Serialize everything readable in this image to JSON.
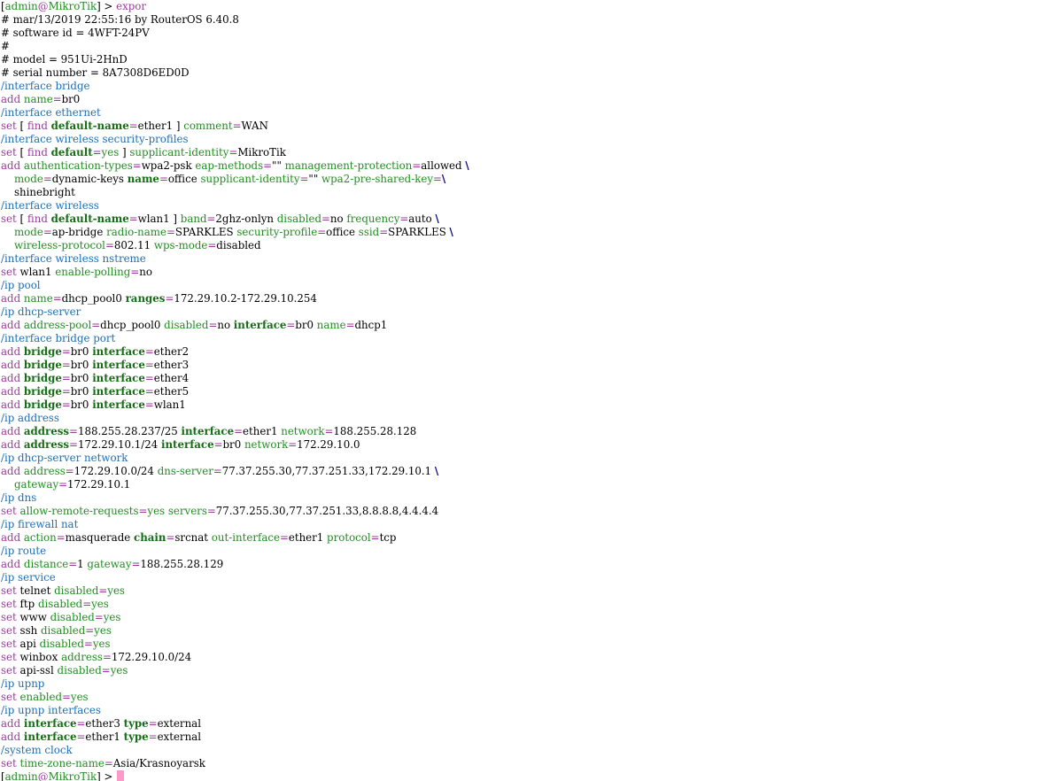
{
  "terminal": {
    "colors": {
      "background": "#ffffff",
      "text": "#000000",
      "section": "#1f6eb5",
      "verb": "#9b3d9b",
      "key": "#238c23",
      "key_bold": "#166d16",
      "continuation": "#000080",
      "cursor": "#ff99cc"
    },
    "lines": [
      [
        [
          "br",
          "["
        ],
        [
          "g",
          "admin"
        ],
        [
          "a",
          "@"
        ],
        [
          "g",
          "MikroTik"
        ],
        [
          "br",
          "] > "
        ],
        [
          "v",
          "expor"
        ]
      ],
      [
        [
          "c",
          "# mar/13/2019 22:55:16 by RouterOS 6.40.8"
        ]
      ],
      [
        [
          "c",
          "# software id = 4WFT-24PV"
        ]
      ],
      [
        [
          "c",
          "#"
        ]
      ],
      [
        [
          "c",
          "# model = 951Ui-2HnD"
        ]
      ],
      [
        [
          "c",
          "# serial number = 8A7308D6ED0D"
        ]
      ],
      [
        [
          "s",
          "/interface bridge"
        ]
      ],
      [
        [
          "v",
          "add "
        ],
        [
          "g",
          "name"
        ],
        [
          "a",
          "="
        ],
        [
          "t",
          "br0"
        ]
      ],
      [
        [
          "s",
          "/interface ethernet"
        ]
      ],
      [
        [
          "v",
          "set "
        ],
        [
          "br",
          "[ "
        ],
        [
          "v",
          "find "
        ],
        [
          "b",
          "default-name"
        ],
        [
          "a",
          "="
        ],
        [
          "t",
          "ether1 "
        ],
        [
          "br",
          "] "
        ],
        [
          "g",
          "comment"
        ],
        [
          "a",
          "="
        ],
        [
          "t",
          "WAN"
        ]
      ],
      [
        [
          "s",
          "/interface wireless security-profiles"
        ]
      ],
      [
        [
          "v",
          "set "
        ],
        [
          "br",
          "[ "
        ],
        [
          "v",
          "find "
        ],
        [
          "b",
          "default"
        ],
        [
          "a",
          "="
        ],
        [
          "g",
          "yes "
        ],
        [
          "br",
          "] "
        ],
        [
          "g",
          "supplicant-identity"
        ],
        [
          "a",
          "="
        ],
        [
          "t",
          "MikroTik"
        ]
      ],
      [
        [
          "v",
          "add "
        ],
        [
          "g",
          "authentication-types"
        ],
        [
          "a",
          "="
        ],
        [
          "t",
          "wpa2-psk "
        ],
        [
          "g",
          "eap-methods"
        ],
        [
          "a",
          "="
        ],
        [
          "t",
          "\"\" "
        ],
        [
          "g",
          "management-protection"
        ],
        [
          "a",
          "="
        ],
        [
          "t",
          "allowed "
        ],
        [
          "x",
          "\\"
        ]
      ],
      [
        [
          "t",
          "    "
        ],
        [
          "g",
          "mode"
        ],
        [
          "a",
          "="
        ],
        [
          "t",
          "dynamic-keys "
        ],
        [
          "b",
          "name"
        ],
        [
          "a",
          "="
        ],
        [
          "t",
          "office "
        ],
        [
          "g",
          "supplicant-identity"
        ],
        [
          "a",
          "="
        ],
        [
          "t",
          "\"\" "
        ],
        [
          "g",
          "wpa2-pre-shared-key"
        ],
        [
          "a",
          "="
        ],
        [
          "x",
          "\\"
        ]
      ],
      [
        [
          "t",
          "    shinebright"
        ]
      ],
      [
        [
          "s",
          "/interface wireless"
        ]
      ],
      [
        [
          "v",
          "set "
        ],
        [
          "br",
          "[ "
        ],
        [
          "v",
          "find "
        ],
        [
          "b",
          "default-name"
        ],
        [
          "a",
          "="
        ],
        [
          "t",
          "wlan1 "
        ],
        [
          "br",
          "] "
        ],
        [
          "g",
          "band"
        ],
        [
          "a",
          "="
        ],
        [
          "t",
          "2ghz-onlyn "
        ],
        [
          "g",
          "disabled"
        ],
        [
          "a",
          "="
        ],
        [
          "t",
          "no "
        ],
        [
          "g",
          "frequency"
        ],
        [
          "a",
          "="
        ],
        [
          "t",
          "auto "
        ],
        [
          "x",
          "\\"
        ]
      ],
      [
        [
          "t",
          "    "
        ],
        [
          "g",
          "mode"
        ],
        [
          "a",
          "="
        ],
        [
          "t",
          "ap-bridge "
        ],
        [
          "g",
          "radio-name"
        ],
        [
          "a",
          "="
        ],
        [
          "t",
          "SPARKLES "
        ],
        [
          "g",
          "security-profile"
        ],
        [
          "a",
          "="
        ],
        [
          "t",
          "office "
        ],
        [
          "g",
          "ssid"
        ],
        [
          "a",
          "="
        ],
        [
          "t",
          "SPARKLES "
        ],
        [
          "x",
          "\\"
        ]
      ],
      [
        [
          "t",
          "    "
        ],
        [
          "g",
          "wireless-protocol"
        ],
        [
          "a",
          "="
        ],
        [
          "t",
          "802.11 "
        ],
        [
          "g",
          "wps-mode"
        ],
        [
          "a",
          "="
        ],
        [
          "t",
          "disabled"
        ]
      ],
      [
        [
          "s",
          "/interface wireless nstreme"
        ]
      ],
      [
        [
          "v",
          "set "
        ],
        [
          "t",
          "wlan1 "
        ],
        [
          "g",
          "enable-polling"
        ],
        [
          "a",
          "="
        ],
        [
          "t",
          "no"
        ]
      ],
      [
        [
          "s",
          "/ip pool"
        ]
      ],
      [
        [
          "v",
          "add "
        ],
        [
          "g",
          "name"
        ],
        [
          "a",
          "="
        ],
        [
          "t",
          "dhcp_pool0 "
        ],
        [
          "b",
          "ranges"
        ],
        [
          "a",
          "="
        ],
        [
          "t",
          "172.29.10.2-172.29.10.254"
        ]
      ],
      [
        [
          "s",
          "/ip dhcp-server"
        ]
      ],
      [
        [
          "v",
          "add "
        ],
        [
          "g",
          "address-pool"
        ],
        [
          "a",
          "="
        ],
        [
          "t",
          "dhcp_pool0 "
        ],
        [
          "g",
          "disabled"
        ],
        [
          "a",
          "="
        ],
        [
          "t",
          "no "
        ],
        [
          "b",
          "interface"
        ],
        [
          "a",
          "="
        ],
        [
          "t",
          "br0 "
        ],
        [
          "g",
          "name"
        ],
        [
          "a",
          "="
        ],
        [
          "t",
          "dhcp1"
        ]
      ],
      [
        [
          "s",
          "/interface bridge port"
        ]
      ],
      [
        [
          "v",
          "add "
        ],
        [
          "b",
          "bridge"
        ],
        [
          "a",
          "="
        ],
        [
          "t",
          "br0 "
        ],
        [
          "b",
          "interface"
        ],
        [
          "a",
          "="
        ],
        [
          "t",
          "ether2"
        ]
      ],
      [
        [
          "v",
          "add "
        ],
        [
          "b",
          "bridge"
        ],
        [
          "a",
          "="
        ],
        [
          "t",
          "br0 "
        ],
        [
          "b",
          "interface"
        ],
        [
          "a",
          "="
        ],
        [
          "t",
          "ether3"
        ]
      ],
      [
        [
          "v",
          "add "
        ],
        [
          "b",
          "bridge"
        ],
        [
          "a",
          "="
        ],
        [
          "t",
          "br0 "
        ],
        [
          "b",
          "interface"
        ],
        [
          "a",
          "="
        ],
        [
          "t",
          "ether4"
        ]
      ],
      [
        [
          "v",
          "add "
        ],
        [
          "b",
          "bridge"
        ],
        [
          "a",
          "="
        ],
        [
          "t",
          "br0 "
        ],
        [
          "b",
          "interface"
        ],
        [
          "a",
          "="
        ],
        [
          "t",
          "ether5"
        ]
      ],
      [
        [
          "v",
          "add "
        ],
        [
          "b",
          "bridge"
        ],
        [
          "a",
          "="
        ],
        [
          "t",
          "br0 "
        ],
        [
          "b",
          "interface"
        ],
        [
          "a",
          "="
        ],
        [
          "t",
          "wlan1"
        ]
      ],
      [
        [
          "s",
          "/ip address"
        ]
      ],
      [
        [
          "v",
          "add "
        ],
        [
          "b",
          "address"
        ],
        [
          "a",
          "="
        ],
        [
          "t",
          "188.255.28.237/25 "
        ],
        [
          "b",
          "interface"
        ],
        [
          "a",
          "="
        ],
        [
          "t",
          "ether1 "
        ],
        [
          "g",
          "network"
        ],
        [
          "a",
          "="
        ],
        [
          "t",
          "188.255.28.128"
        ]
      ],
      [
        [
          "v",
          "add "
        ],
        [
          "b",
          "address"
        ],
        [
          "a",
          "="
        ],
        [
          "t",
          "172.29.10.1/24 "
        ],
        [
          "b",
          "interface"
        ],
        [
          "a",
          "="
        ],
        [
          "t",
          "br0 "
        ],
        [
          "g",
          "network"
        ],
        [
          "a",
          "="
        ],
        [
          "t",
          "172.29.10.0"
        ]
      ],
      [
        [
          "s",
          "/ip dhcp-server network"
        ]
      ],
      [
        [
          "v",
          "add "
        ],
        [
          "g",
          "address"
        ],
        [
          "a",
          "="
        ],
        [
          "t",
          "172.29.10.0/24 "
        ],
        [
          "g",
          "dns-server"
        ],
        [
          "a",
          "="
        ],
        [
          "t",
          "77.37.255.30,77.37.251.33,172.29.10.1 "
        ],
        [
          "x",
          "\\"
        ]
      ],
      [
        [
          "t",
          "    "
        ],
        [
          "g",
          "gateway"
        ],
        [
          "a",
          "="
        ],
        [
          "t",
          "172.29.10.1"
        ]
      ],
      [
        [
          "s",
          "/ip dns"
        ]
      ],
      [
        [
          "v",
          "set "
        ],
        [
          "g",
          "allow-remote-requests"
        ],
        [
          "a",
          "="
        ],
        [
          "g",
          "yes "
        ],
        [
          "g",
          "servers"
        ],
        [
          "a",
          "="
        ],
        [
          "t",
          "77.37.255.30,77.37.251.33,8.8.8.8,4.4.4.4"
        ]
      ],
      [
        [
          "s",
          "/ip firewall nat"
        ]
      ],
      [
        [
          "v",
          "add "
        ],
        [
          "g",
          "action"
        ],
        [
          "a",
          "="
        ],
        [
          "t",
          "masquerade "
        ],
        [
          "b",
          "chain"
        ],
        [
          "a",
          "="
        ],
        [
          "t",
          "srcnat "
        ],
        [
          "g",
          "out-interface"
        ],
        [
          "a",
          "="
        ],
        [
          "t",
          "ether1 "
        ],
        [
          "g",
          "protocol"
        ],
        [
          "a",
          "="
        ],
        [
          "t",
          "tcp"
        ]
      ],
      [
        [
          "s",
          "/ip route"
        ]
      ],
      [
        [
          "v",
          "add "
        ],
        [
          "g",
          "distance"
        ],
        [
          "a",
          "="
        ],
        [
          "t",
          "1 "
        ],
        [
          "g",
          "gateway"
        ],
        [
          "a",
          "="
        ],
        [
          "t",
          "188.255.28.129"
        ]
      ],
      [
        [
          "s",
          "/ip service"
        ]
      ],
      [
        [
          "v",
          "set "
        ],
        [
          "t",
          "telnet "
        ],
        [
          "g",
          "disabled"
        ],
        [
          "a",
          "="
        ],
        [
          "g",
          "yes"
        ]
      ],
      [
        [
          "v",
          "set "
        ],
        [
          "t",
          "ftp "
        ],
        [
          "g",
          "disabled"
        ],
        [
          "a",
          "="
        ],
        [
          "g",
          "yes"
        ]
      ],
      [
        [
          "v",
          "set "
        ],
        [
          "t",
          "www "
        ],
        [
          "g",
          "disabled"
        ],
        [
          "a",
          "="
        ],
        [
          "g",
          "yes"
        ]
      ],
      [
        [
          "v",
          "set "
        ],
        [
          "t",
          "ssh "
        ],
        [
          "g",
          "disabled"
        ],
        [
          "a",
          "="
        ],
        [
          "g",
          "yes"
        ]
      ],
      [
        [
          "v",
          "set "
        ],
        [
          "t",
          "api "
        ],
        [
          "g",
          "disabled"
        ],
        [
          "a",
          "="
        ],
        [
          "g",
          "yes"
        ]
      ],
      [
        [
          "v",
          "set "
        ],
        [
          "t",
          "winbox "
        ],
        [
          "g",
          "address"
        ],
        [
          "a",
          "="
        ],
        [
          "t",
          "172.29.10.0/24"
        ]
      ],
      [
        [
          "v",
          "set "
        ],
        [
          "t",
          "api-ssl "
        ],
        [
          "g",
          "disabled"
        ],
        [
          "a",
          "="
        ],
        [
          "g",
          "yes"
        ]
      ],
      [
        [
          "s",
          "/ip upnp"
        ]
      ],
      [
        [
          "v",
          "set "
        ],
        [
          "g",
          "enabled"
        ],
        [
          "a",
          "="
        ],
        [
          "g",
          "yes"
        ]
      ],
      [
        [
          "s",
          "/ip upnp interfaces"
        ]
      ],
      [
        [
          "v",
          "add "
        ],
        [
          "b",
          "interface"
        ],
        [
          "a",
          "="
        ],
        [
          "t",
          "ether3 "
        ],
        [
          "b",
          "type"
        ],
        [
          "a",
          "="
        ],
        [
          "t",
          "external"
        ]
      ],
      [
        [
          "v",
          "add "
        ],
        [
          "b",
          "interface"
        ],
        [
          "a",
          "="
        ],
        [
          "t",
          "ether1 "
        ],
        [
          "b",
          "type"
        ],
        [
          "a",
          "="
        ],
        [
          "t",
          "external"
        ]
      ],
      [
        [
          "s",
          "/system clock"
        ]
      ],
      [
        [
          "v",
          "set "
        ],
        [
          "g",
          "time-zone-name"
        ],
        [
          "a",
          "="
        ],
        [
          "t",
          "Asia/Krasnoyarsk"
        ]
      ],
      [
        [
          "br",
          "["
        ],
        [
          "g",
          "admin"
        ],
        [
          "a",
          "@"
        ],
        [
          "g",
          "MikroTik"
        ],
        [
          "br",
          "] > "
        ]
      ]
    ],
    "cursor_line": 58
  }
}
